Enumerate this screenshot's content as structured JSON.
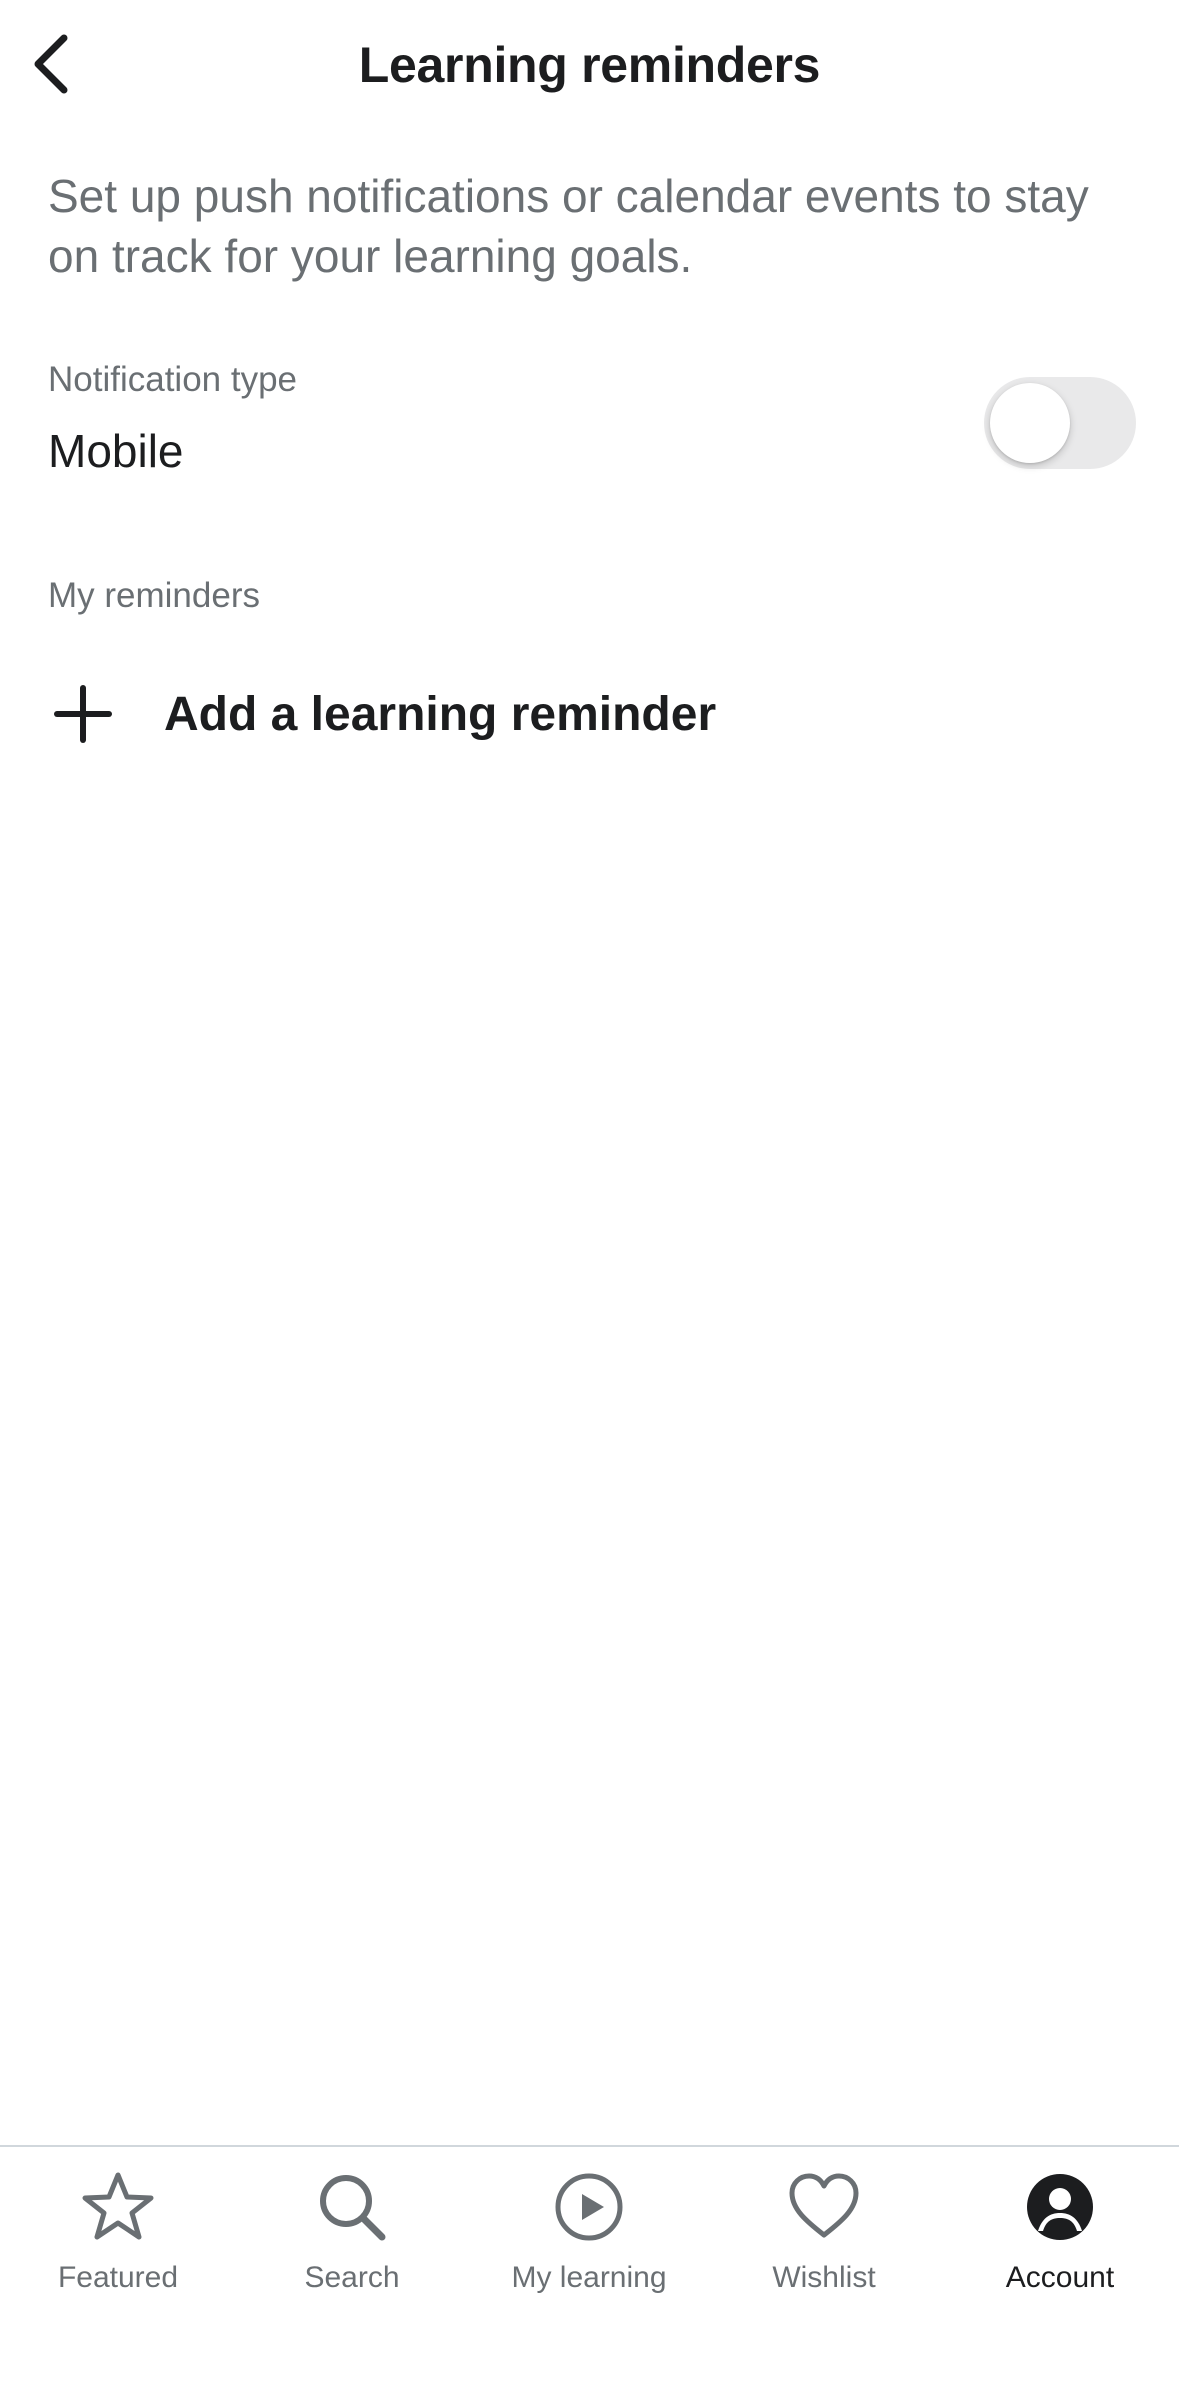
{
  "header": {
    "title": "Learning reminders",
    "back_icon": "chevron-left-icon"
  },
  "intro": {
    "description": "Set up push notifications or calendar events to stay on track for your learning goals."
  },
  "notification": {
    "label": "Notification type",
    "value": "Mobile",
    "toggle_on": false
  },
  "reminders": {
    "section_label": "My reminders",
    "add_label": "Add a learning reminder",
    "add_icon": "plus-icon"
  },
  "bottom_nav": {
    "items": [
      {
        "label": "Featured",
        "icon": "star-icon",
        "active": false
      },
      {
        "label": "Search",
        "icon": "search-icon",
        "active": false
      },
      {
        "label": "My learning",
        "icon": "play-circle-icon",
        "active": false
      },
      {
        "label": "Wishlist",
        "icon": "heart-icon",
        "active": false
      },
      {
        "label": "Account",
        "icon": "account-icon",
        "active": true
      }
    ]
  },
  "colors": {
    "text_primary": "#1c1d1f",
    "text_secondary": "#6a6f73",
    "toggle_off_track": "#e9e9ea",
    "divider": "#d1d7dc"
  }
}
